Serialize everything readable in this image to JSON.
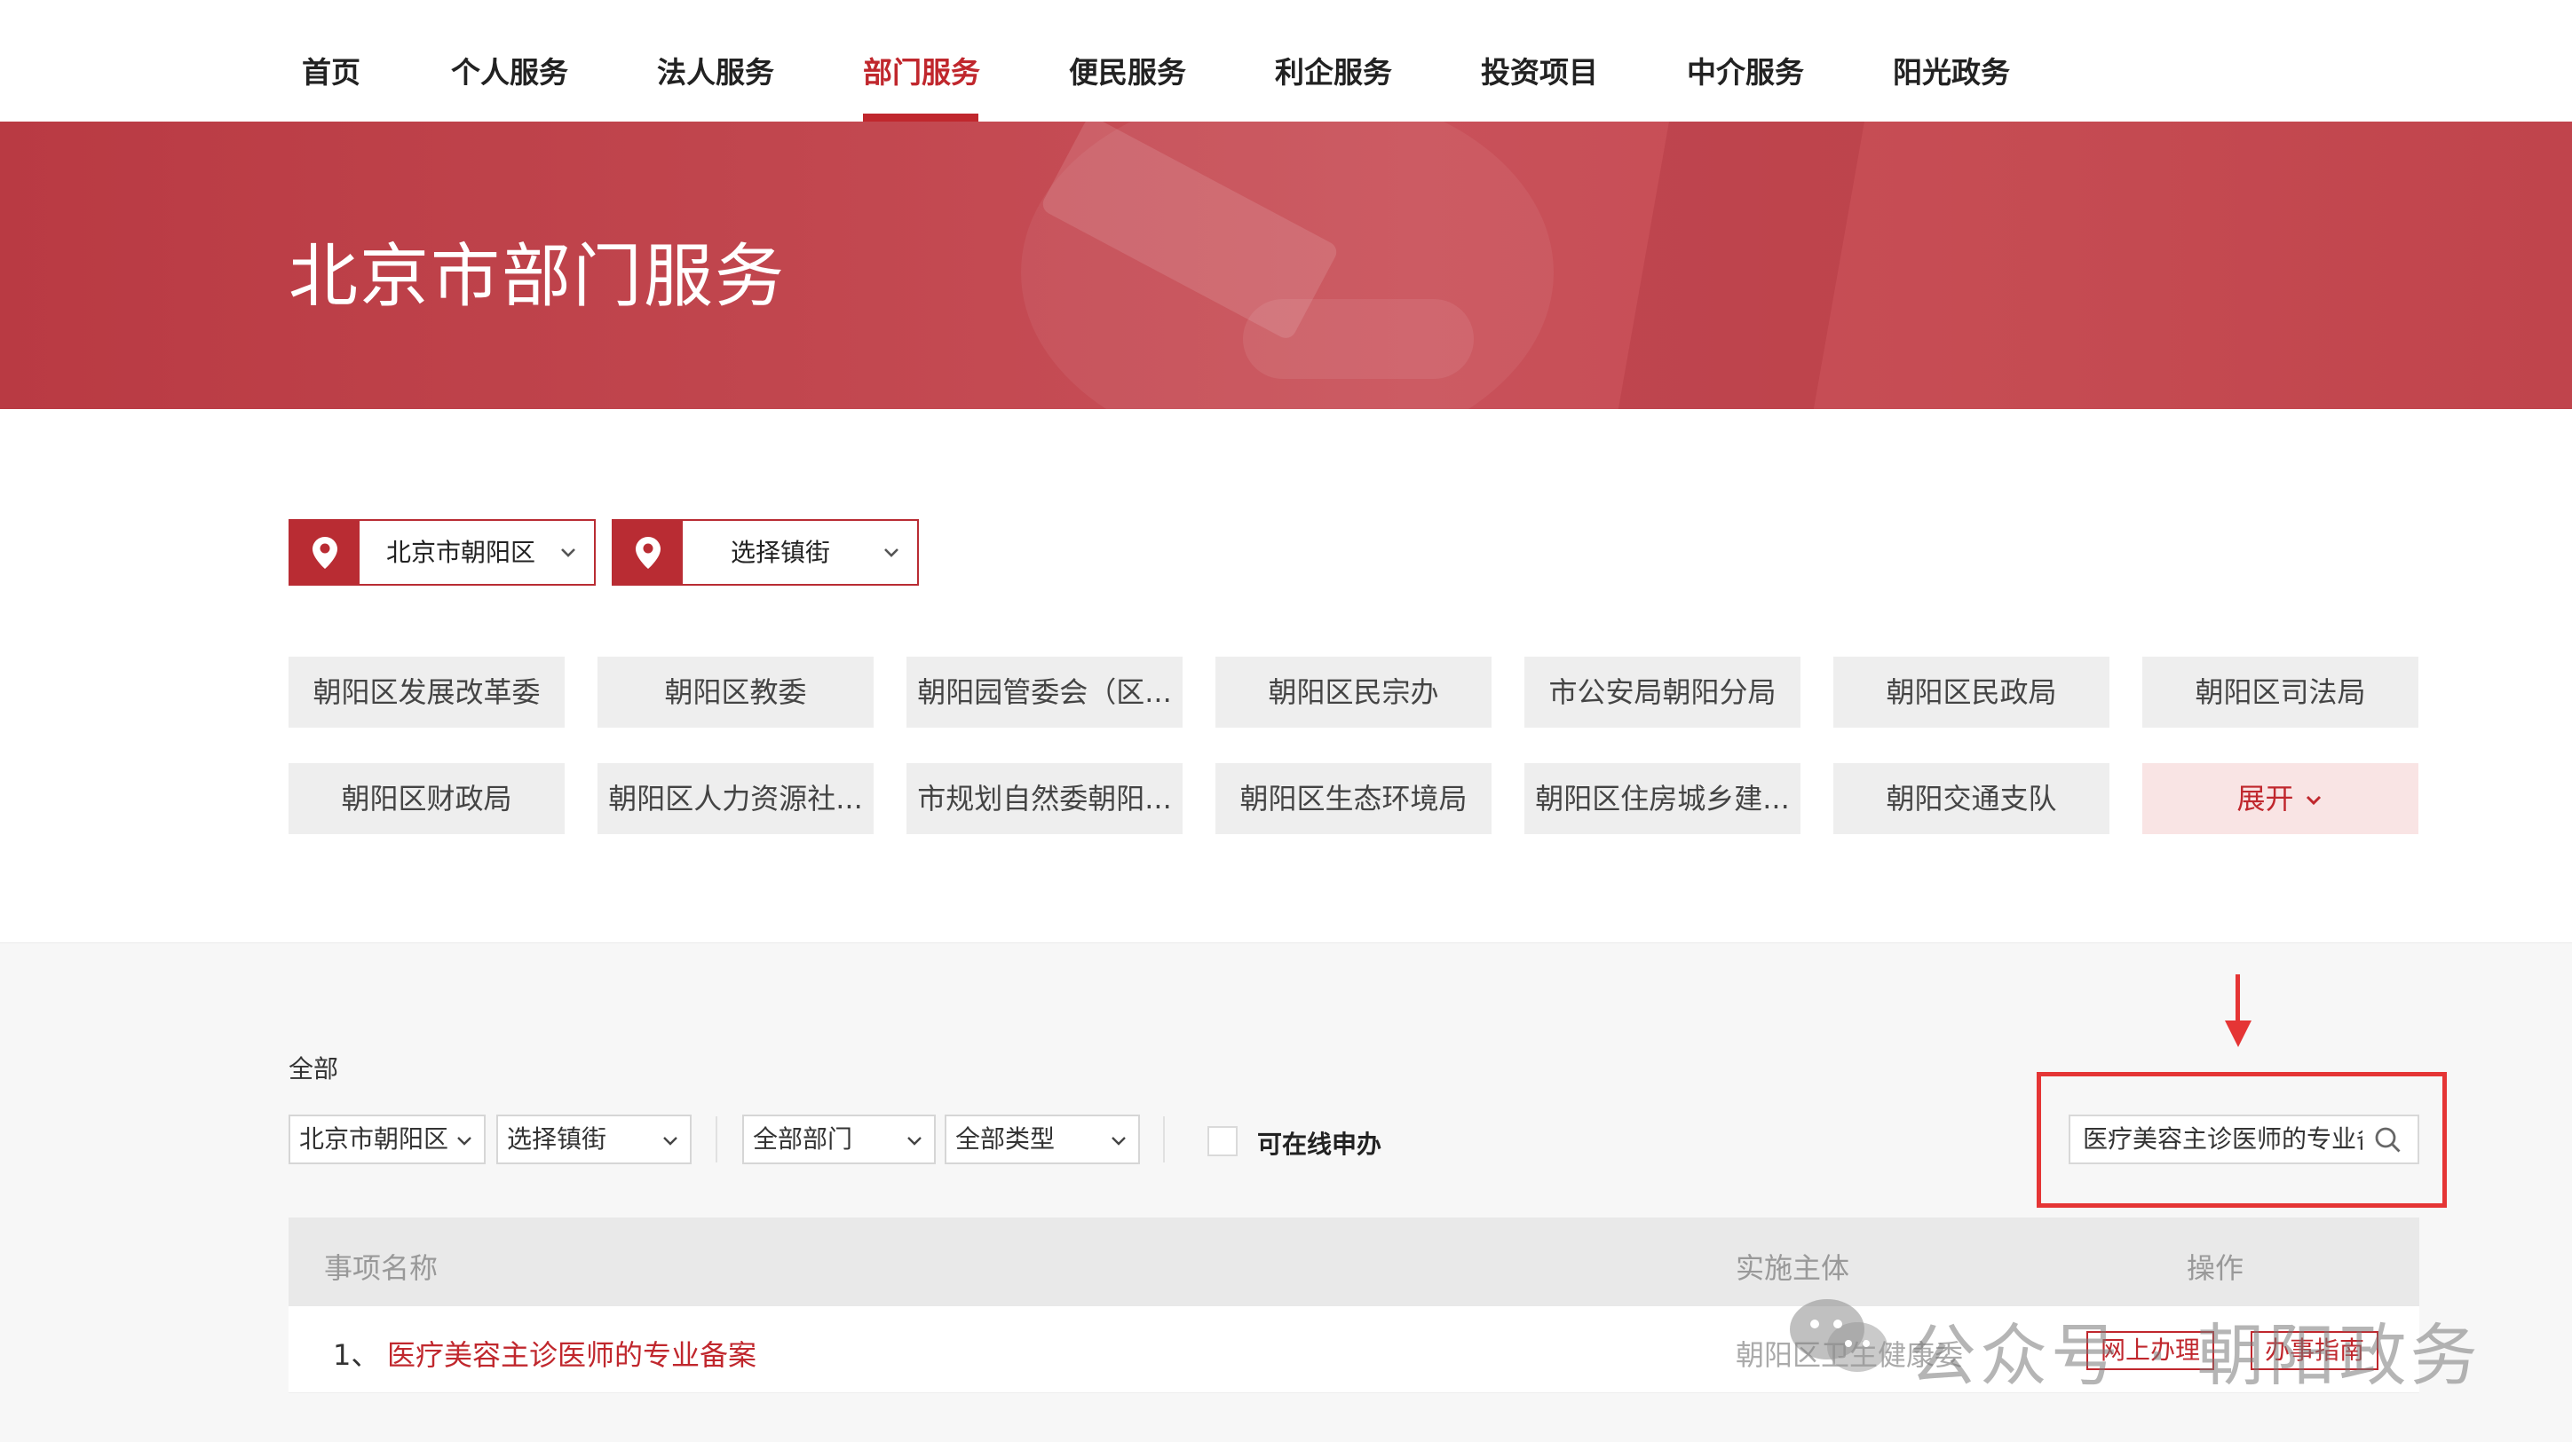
{
  "nav": {
    "items": [
      {
        "label": "首页"
      },
      {
        "label": "个人服务"
      },
      {
        "label": "法人服务"
      },
      {
        "label": "部门服务",
        "active": true
      },
      {
        "label": "便民服务"
      },
      {
        "label": "利企服务"
      },
      {
        "label": "投资项目"
      },
      {
        "label": "中介服务"
      },
      {
        "label": "阳光政务"
      }
    ]
  },
  "banner": {
    "title": "北京市部门服务"
  },
  "location": {
    "district": "北京市朝阳区",
    "street": "选择镇街",
    "icons": [
      "location-pin-icon",
      "chevron-down-icon"
    ]
  },
  "departments": {
    "row1": [
      "朝阳区发展改革委",
      "朝阳区教委",
      "朝阳园管委会（区...",
      "朝阳区民宗办",
      "市公安局朝阳分局",
      "朝阳区民政局",
      "朝阳区司法局"
    ],
    "row2": [
      "朝阳区财政局",
      "朝阳区人力资源社...",
      "市规划自然委朝阳...",
      "朝阳区生态环境局",
      "朝阳区住房城乡建...",
      "朝阳交通支队"
    ],
    "expand_label": "展开"
  },
  "filters": {
    "all_label": "全部",
    "district": "北京市朝阳区",
    "street": "选择镇街",
    "department": "全部部门",
    "type": "全部类型",
    "online_label": "可在线申办",
    "search_value": "医疗美容主诊医师的专业备案"
  },
  "table": {
    "headers": {
      "name": "事项名称",
      "entity": "实施主体",
      "action": "操作"
    },
    "rows": [
      {
        "index": "1、",
        "name": "医疗美容主诊医师的专业备案",
        "entity": "朝阳区卫生健康委",
        "online_btn": "网上办理",
        "guide_btn": "办事指南"
      }
    ]
  },
  "watermark": {
    "text": "公众号 · 朝阳政务"
  },
  "colors": {
    "accent": "#c0272d",
    "annotation": "#e53535"
  }
}
